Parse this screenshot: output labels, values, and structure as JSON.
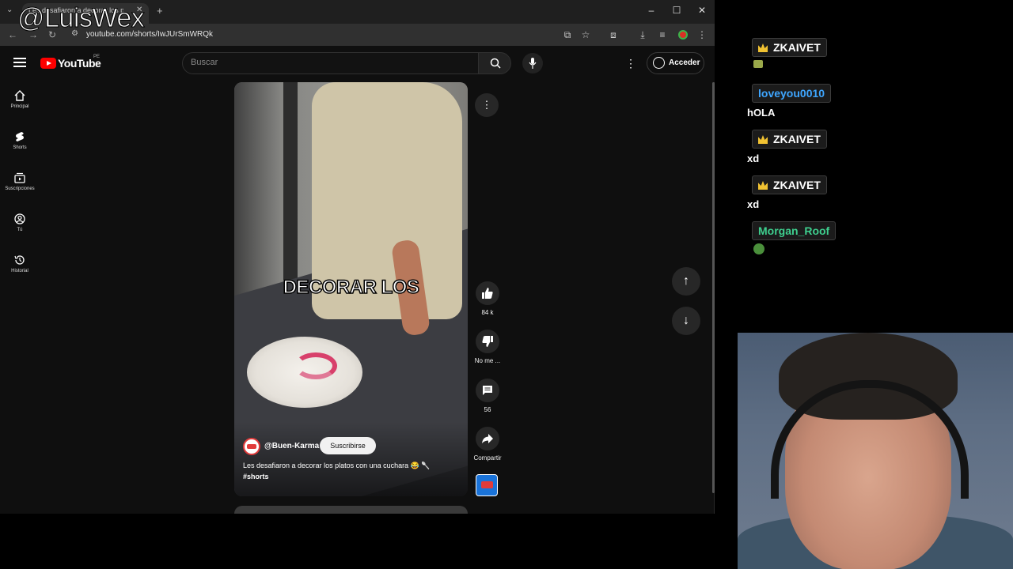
{
  "overlay": {
    "watermark": "@LuisWex"
  },
  "browser": {
    "tab_title": "Les desafiaron a decorar los pl...",
    "url": "youtube.com/shorts/IwJUrSmWRQk"
  },
  "youtube": {
    "brand": "YouTube",
    "region": "PE",
    "search_placeholder": "Buscar",
    "signin_label": "Acceder",
    "sidebar": [
      {
        "label": "Principal",
        "icon": "home-icon"
      },
      {
        "label": "Shorts",
        "icon": "shorts-icon"
      },
      {
        "label": "Suscripciones",
        "icon": "subscriptions-icon"
      },
      {
        "label": "Tú",
        "icon": "you-icon"
      },
      {
        "label": "Historial",
        "icon": "history-icon"
      }
    ],
    "short": {
      "overlay_caption": "DECORAR LOS",
      "channel": "@Buen-Karma",
      "subscribe_label": "Suscribirse",
      "title": "Les desafiaron a decorar los platos con una cuchara 😂 🥄",
      "hashtag": "#shorts"
    },
    "actions": {
      "likes": "84 k",
      "dislike_label": "No me ...",
      "comments": "56",
      "share_label": "Compartir"
    }
  },
  "chat": [
    {
      "user": "ZKAIVET",
      "user_color": "#ffffff",
      "badge": "crown",
      "message": "",
      "emote": "emote"
    },
    {
      "user": "loveyou0010",
      "user_color": "#3ea6ff",
      "badge": "",
      "message": "hOLA",
      "emote": ""
    },
    {
      "user": "ZKAIVET",
      "user_color": "#ffffff",
      "badge": "crown",
      "message": "xd",
      "emote": ""
    },
    {
      "user": "ZKAIVET",
      "user_color": "#ffffff",
      "badge": "crown",
      "message": "xd",
      "emote": ""
    },
    {
      "user": "Morgan_Roof",
      "user_color": "#3ecf8e",
      "badge": "",
      "message": "",
      "emote": "emote"
    }
  ]
}
